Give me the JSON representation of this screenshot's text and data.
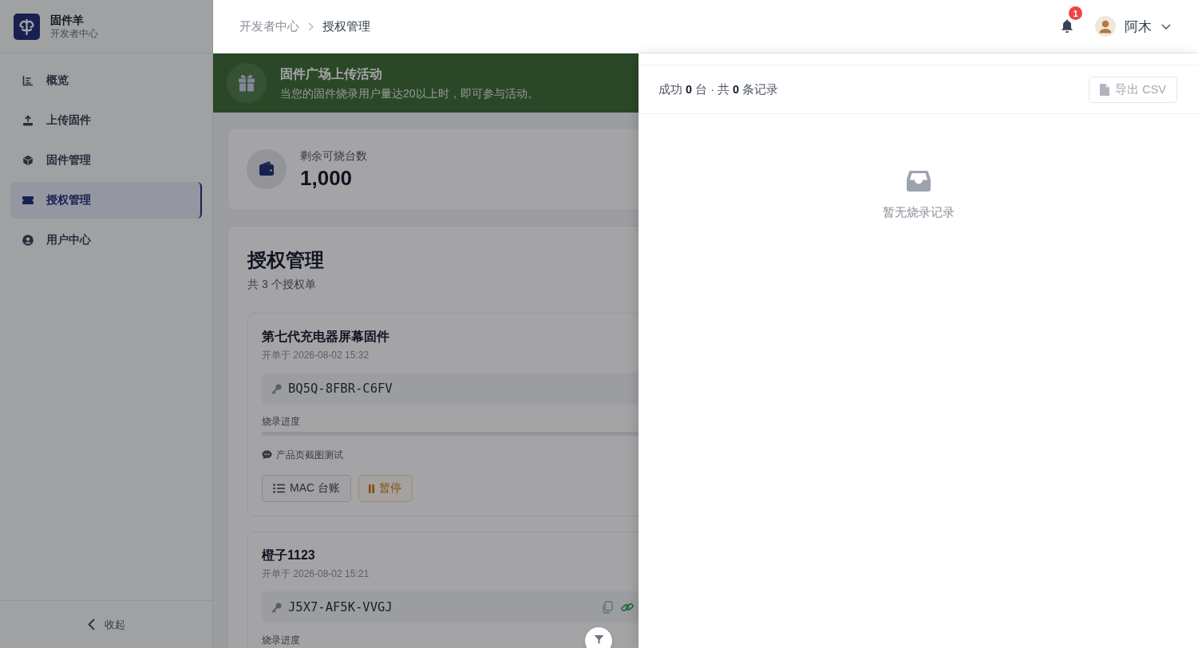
{
  "sidebar": {
    "brand": {
      "name": "固件羊",
      "subtitle": "开发者中心"
    },
    "items": [
      {
        "label": "概览",
        "selected": false
      },
      {
        "label": "上传固件",
        "selected": false
      },
      {
        "label": "固件管理",
        "selected": false
      },
      {
        "label": "授权管理",
        "selected": true
      },
      {
        "label": "用户中心",
        "selected": false
      }
    ],
    "collapse_label": "收起"
  },
  "header": {
    "breadcrumb": [
      {
        "label": "开发者中心",
        "current": false
      },
      {
        "label": "授权管理",
        "current": true
      }
    ],
    "notification_count": "1",
    "user_name": "阿木"
  },
  "banner": {
    "title": "固件广场上传活动",
    "text": "当您的固件烧录用户量达20以上时，即可参与活动。"
  },
  "stats": {
    "label": "剩余可烧台数",
    "value": "1,000"
  },
  "licenses": {
    "title": "授权管理",
    "count_text": "共 3 个授权单",
    "orders": [
      {
        "name": "第七代充电器屏幕固件",
        "opened": "开单于 2026-08-02 15:32",
        "key": "BQ5Q-8FBR-C6FV",
        "key_actions": false,
        "progress_label": "烧录进度",
        "progress_bar": true,
        "note": "产品页截图测试",
        "actions": [
          {
            "kind": "ledger",
            "label": "MAC 台账"
          },
          {
            "kind": "pause",
            "label": "暂停"
          }
        ]
      },
      {
        "name": "橙子1123",
        "opened": "开单于 2026-08-02 15:21",
        "key": "J5X7-AF5K-VVGJ",
        "key_actions": true,
        "progress_label": "烧录进度"
      }
    ]
  },
  "drawer": {
    "open": true,
    "summary": "成功 **0** 台 · 共 **0** 条记录",
    "export_button": {
      "label": "导出 CSV",
      "disabled": true
    },
    "empty_text": "暂无烧录记录"
  }
}
